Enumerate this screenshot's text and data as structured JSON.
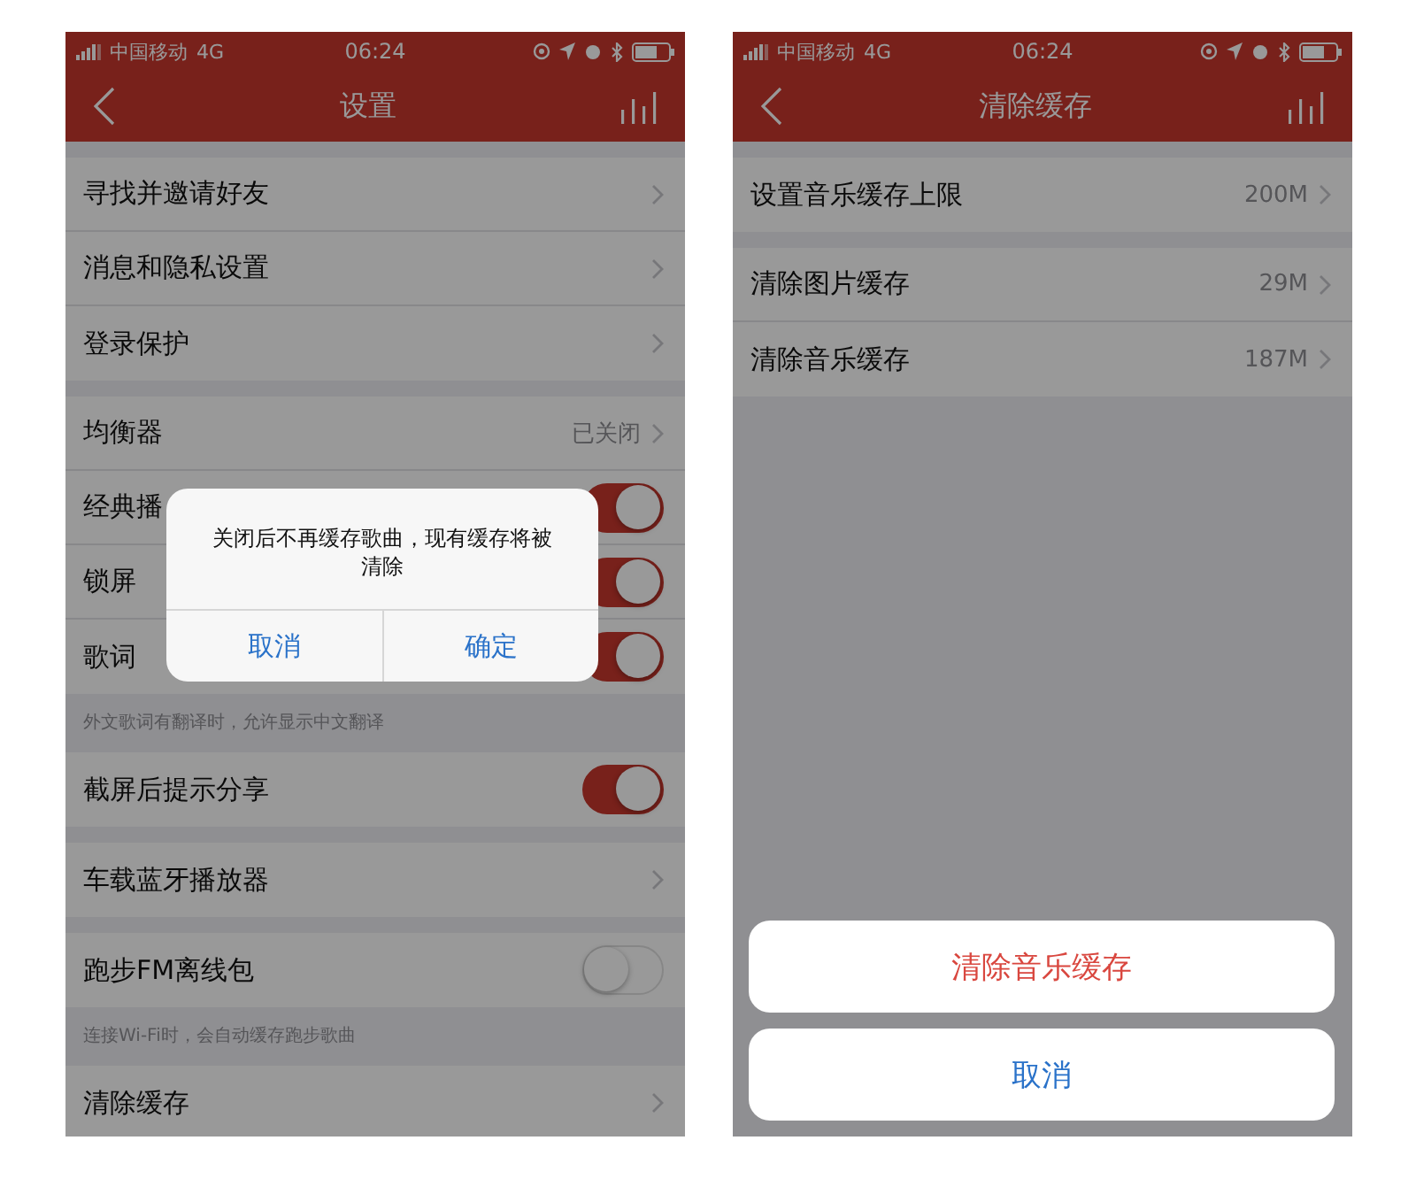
{
  "screens": [
    {
      "dimmed": true,
      "status_bar": {
        "carrier": "中国移动",
        "network": "4G",
        "time": "06:24"
      },
      "nav": {
        "title": "设置"
      },
      "groups": [
        {
          "items": [
            {
              "kind": "link",
              "label": "寻找并邀请好友"
            },
            {
              "kind": "link",
              "label": "消息和隐私设置"
            },
            {
              "kind": "link",
              "label": "登录保护"
            }
          ]
        },
        {
          "items": [
            {
              "kind": "link",
              "label": "均衡器",
              "value": "已关闭"
            },
            {
              "kind": "toggle",
              "label": "经典播",
              "on": true
            },
            {
              "kind": "toggle",
              "label": "锁屏",
              "on": true
            },
            {
              "kind": "toggle",
              "label": "歌词",
              "on": true
            }
          ],
          "footnote": "外文歌词有翻译时，允许显示中文翻译"
        },
        {
          "items": [
            {
              "kind": "toggle",
              "label": "截屏后提示分享",
              "on": true
            }
          ]
        },
        {
          "items": [
            {
              "kind": "link",
              "label": "车载蓝牙播放器"
            }
          ]
        },
        {
          "items": [
            {
              "kind": "toggle",
              "label": "跑步FM离线包",
              "on": false
            }
          ],
          "footnote": "连接Wi-Fi时，会自动缓存跑步歌曲"
        },
        {
          "items": [
            {
              "kind": "link",
              "label": "清除缓存"
            }
          ]
        }
      ],
      "dialog": {
        "message": "关闭后不再缓存歌曲，现有缓存将被清除",
        "buttons": [
          "取消",
          "确定"
        ]
      }
    },
    {
      "dimmed": true,
      "status_bar": {
        "carrier": "中国移动",
        "network": "4G",
        "time": "06:24"
      },
      "nav": {
        "title": "清除缓存"
      },
      "groups": [
        {
          "items": [
            {
              "kind": "link",
              "label": "设置音乐缓存上限",
              "value": "200M"
            }
          ]
        },
        {
          "items": [
            {
              "kind": "link",
              "label": "清除图片缓存",
              "value": "29M"
            },
            {
              "kind": "link",
              "label": "清除音乐缓存",
              "value": "187M"
            }
          ]
        }
      ],
      "action_sheet": {
        "buttons": [
          {
            "kind": "destructive",
            "label": "清除音乐缓存"
          },
          {
            "kind": "cancel",
            "label": "取消"
          }
        ]
      }
    }
  ]
}
